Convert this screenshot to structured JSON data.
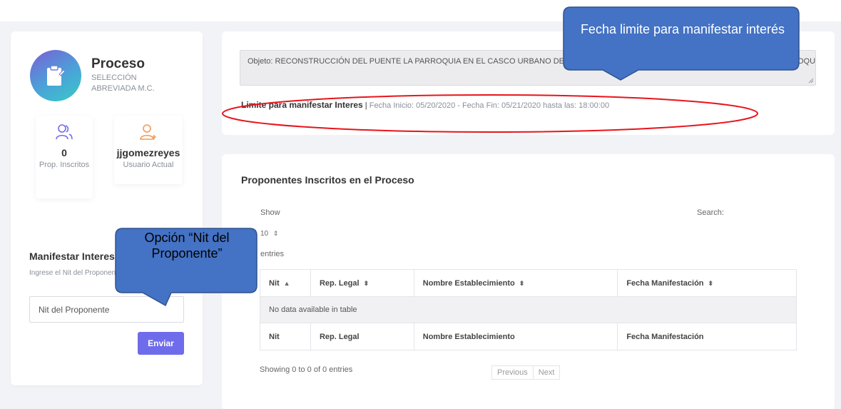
{
  "process": {
    "title": "Proceso",
    "subtitle": "SELECCIÓN ABREVIADA M.C."
  },
  "stats": {
    "proponents_count": "0",
    "proponents_label": "Prop. Inscritos",
    "user_name": "jjgomezreyes",
    "user_label": "Usuario Actual"
  },
  "manifest": {
    "title": "Manifestar Interes",
    "subtitle": "Ingrese el Nit del Proponente",
    "nit_placeholder": "Nit del Proponente",
    "submit_label": "Enviar"
  },
  "objeto": {
    "text": "Objeto: RECONSTRUCCIÓN DEL PUENTE LA PARROQUIA EN EL CASCO URBANO DEL MUNICIPIO DE PUERTO TRIUNFO, DEPARTAMENTO DE ANTIOQUIA, SEGÚN LOS DISEÑOS EXISTENTES DEL PUENTE"
  },
  "limit": {
    "label": "Limite para manifestar Interes",
    "separator": "|",
    "details": "Fecha Inicio: 05/20/2020 - Fecha Fin: 05/21/2020 hasta las: 18:00:00"
  },
  "proponents": {
    "title": "Proponentes Inscritos en el Proceso",
    "show_label": "Show",
    "page_size": "10",
    "entries_label": "entries",
    "search_label": "Search:",
    "columns": [
      "Nit",
      "Rep. Legal",
      "Nombre Establecimiento",
      "Fecha Manifestación"
    ],
    "empty_message": "No data available in table",
    "info": "Showing 0 to 0 of 0 entries",
    "prev_label": "Previous",
    "next_label": "Next"
  },
  "annotations": {
    "callout_top": "Fecha limite para manifestar interés",
    "callout_left": "Opción “Nit del Proponente”"
  },
  "colors": {
    "accent": "#6f6cec",
    "callout_fill": "#4472c4",
    "ellipse_stroke": "#e8141b"
  }
}
